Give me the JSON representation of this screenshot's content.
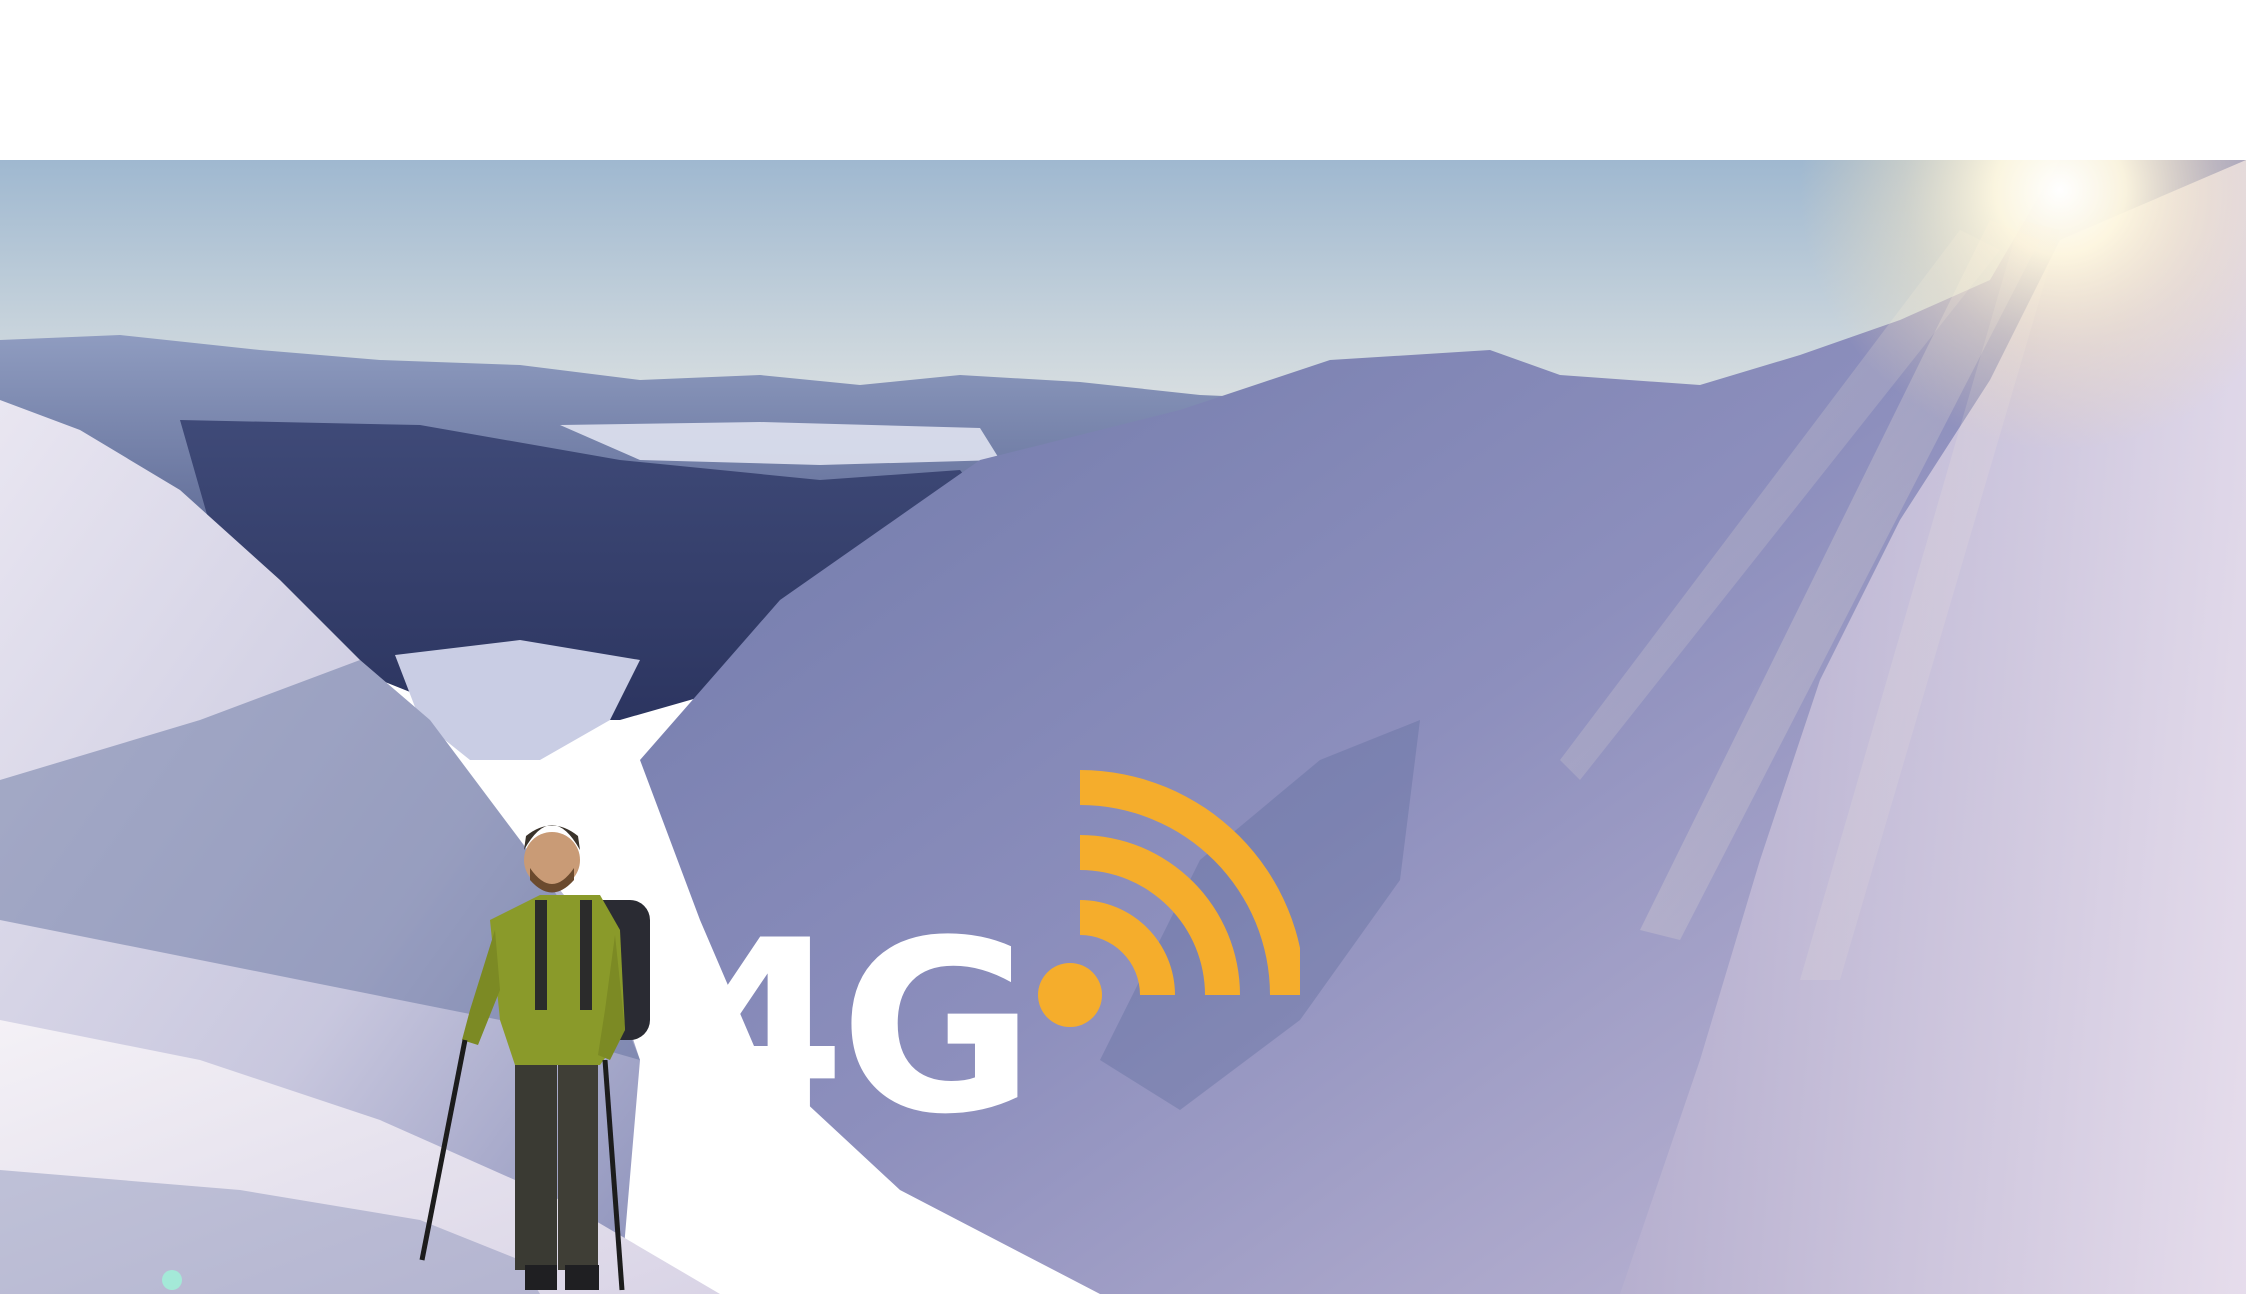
{
  "logo": {
    "text": "4G",
    "text_color": "#ffffff",
    "accent_color": "#f5ad2c",
    "icon": "wifi-signal-icon"
  },
  "scene": {
    "subject": "hiker-with-poles",
    "sky_top": "#9fb8d0",
    "sky_horizon": "#f1e4c9",
    "snow_shadow": "#5c6a9a",
    "snow_lit": "#e8e3ee",
    "sun_color": "#fff8e8",
    "jacket_color": "#8a9a2a"
  }
}
